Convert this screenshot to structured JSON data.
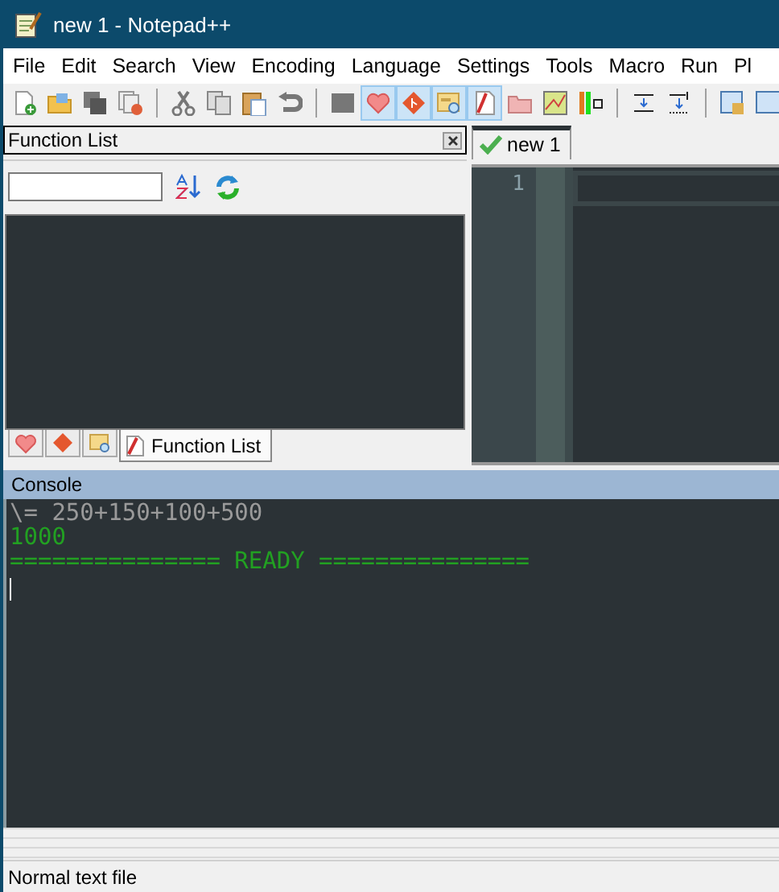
{
  "window": {
    "title": "new 1 - Notepad++"
  },
  "menu": [
    "File",
    "Edit",
    "Search",
    "View",
    "Encoding",
    "Language",
    "Settings",
    "Tools",
    "Macro",
    "Run",
    "Pl"
  ],
  "toolbar": [
    {
      "kind": "button",
      "pressed": false
    },
    {
      "kind": "button",
      "pressed": false
    },
    {
      "kind": "button",
      "pressed": false
    },
    {
      "kind": "button",
      "pressed": false
    },
    {
      "kind": "separator"
    },
    {
      "kind": "button",
      "pressed": false
    },
    {
      "kind": "button",
      "pressed": false
    },
    {
      "kind": "button",
      "pressed": false
    },
    {
      "kind": "button",
      "pressed": false
    },
    {
      "kind": "separator"
    },
    {
      "kind": "button",
      "pressed": false
    },
    {
      "kind": "button",
      "pressed": true
    },
    {
      "kind": "button",
      "pressed": true
    },
    {
      "kind": "button",
      "pressed": true
    },
    {
      "kind": "button",
      "pressed": true
    },
    {
      "kind": "button",
      "pressed": false
    },
    {
      "kind": "button",
      "pressed": false
    },
    {
      "kind": "button",
      "pressed": false
    },
    {
      "kind": "separator"
    },
    {
      "kind": "button",
      "pressed": false
    },
    {
      "kind": "button",
      "pressed": false
    },
    {
      "kind": "separator"
    },
    {
      "kind": "button",
      "pressed": false
    },
    {
      "kind": "button",
      "pressed": false
    }
  ],
  "function_list": {
    "title": "Function List",
    "tabs": [
      {
        "kind": "icon",
        "selected": false
      },
      {
        "kind": "icon",
        "selected": false
      },
      {
        "kind": "icon",
        "selected": false
      },
      {
        "kind": "label",
        "label": "Function List",
        "selected": true
      }
    ]
  },
  "editor": {
    "tabs": [
      {
        "label": "new 1",
        "selected": true
      }
    ],
    "line_numbers": [
      "1"
    ]
  },
  "console": {
    "title": "Console",
    "lines": [
      {
        "kind": "input",
        "text": "\\= 250+150+100+500"
      },
      {
        "kind": "result",
        "text": "1000"
      },
      {
        "kind": "status",
        "text": "=============== READY ==============="
      }
    ]
  },
  "status_bar": {
    "text": "Normal text file"
  }
}
